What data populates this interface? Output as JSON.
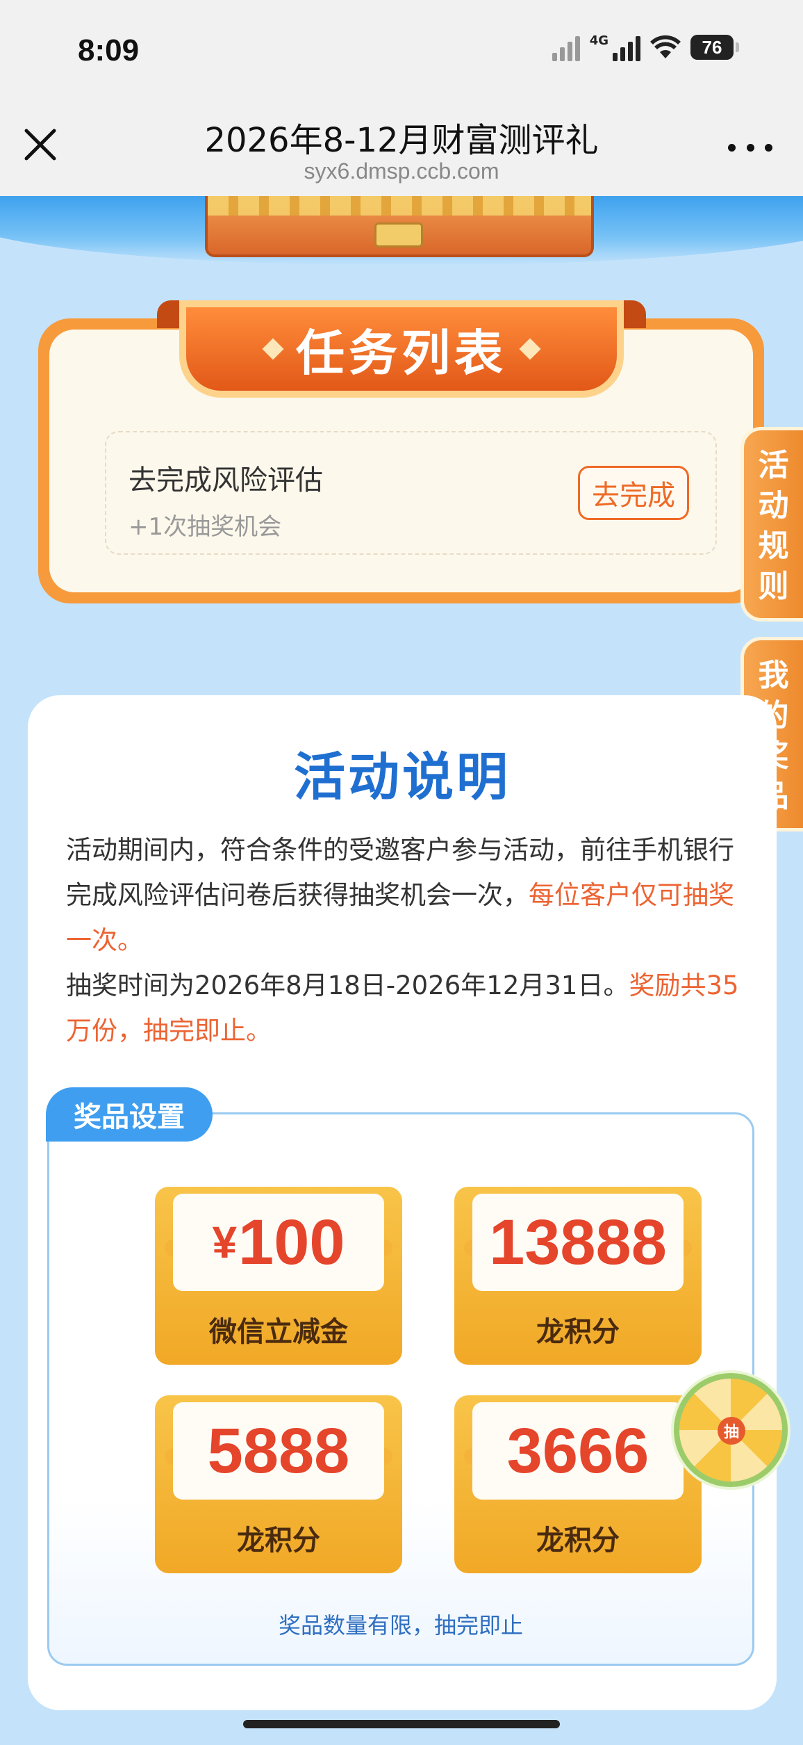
{
  "status_bar": {
    "time": "8:09",
    "network": "4G",
    "battery": "76"
  },
  "header": {
    "title": "2026年8-12月财富测评礼",
    "url": "syx6.dmsp.ccb.com"
  },
  "task_section": {
    "title": "任务列表",
    "task": {
      "name": "去完成风险评估",
      "reward": "+1次抽奖机会",
      "button": "去完成"
    }
  },
  "side_tabs": {
    "rules": "活动规则",
    "prizes": "我的奖品"
  },
  "description": {
    "title": "活动说明",
    "p1": "活动期间内，符合条件的受邀客户参与活动，前往手机银行完成风险评估问卷后获得抽奖机会一次，",
    "p1_highlight": "每位客户仅可抽奖一次。",
    "p2": "抽奖时间为2026年8月18日-2026年12月31日。",
    "p2_highlight": "奖励共35万份，抽完即止。"
  },
  "prize_settings": {
    "tag": "奖品设置",
    "prizes": [
      {
        "currency": "¥",
        "amount": "100",
        "label": "微信立减金"
      },
      {
        "currency": "",
        "amount": "13888",
        "label": "龙积分"
      },
      {
        "currency": "",
        "amount": "5888",
        "label": "龙积分"
      },
      {
        "currency": "",
        "amount": "3666",
        "label": "龙积分"
      }
    ],
    "footer": "奖品数量有限，抽完即止"
  },
  "wheel": {
    "label": "抽"
  }
}
